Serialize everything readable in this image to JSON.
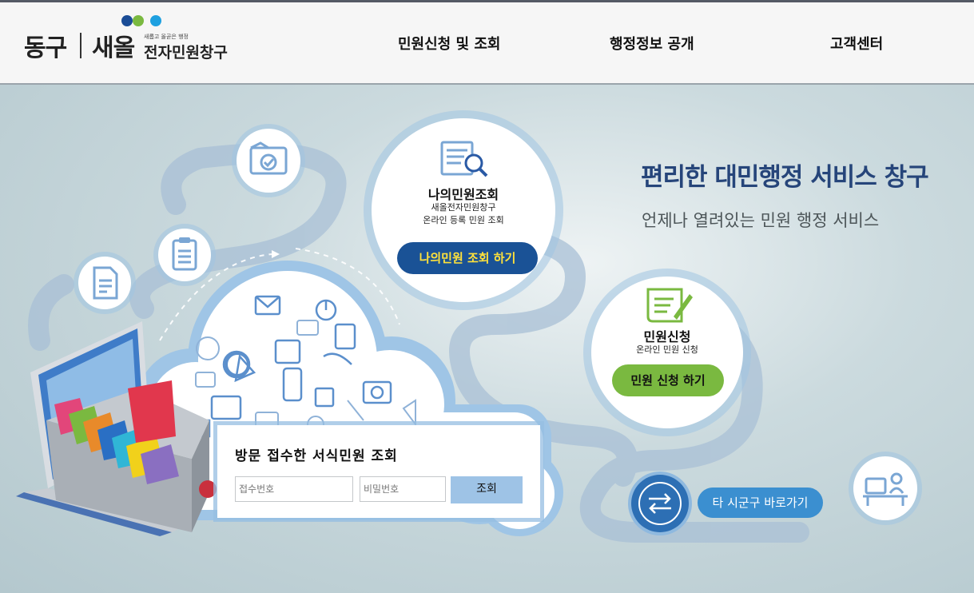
{
  "header": {
    "logo": {
      "district": "동구",
      "brand": "새올",
      "slogan": "새롭고 올곧은 행정",
      "service": "전자민원창구"
    },
    "nav": [
      {
        "label": "민원신청 및 조회"
      },
      {
        "label": "행정정보 공개"
      },
      {
        "label": "고객센터"
      }
    ]
  },
  "hero": {
    "title": "편리한 대민행정 서비스 창구",
    "subtitle": "언제나 열려있는 민원 행정 서비스"
  },
  "my_petition": {
    "title": "나의민원조회",
    "desc_line1": "새올전자민원창구",
    "desc_line2": "온라인 등록 민원 조회",
    "button_label": "나의민원 조회 하기",
    "icon": "document-search-icon"
  },
  "petition_apply": {
    "title": "민원신청",
    "desc": "온라인 민원 신청",
    "button_label": "민원 신청 하기",
    "icon": "scroll-pen-icon"
  },
  "lookup": {
    "title": "방문 접수한 서식민원 조회",
    "receipt_placeholder": "접수번호",
    "password_placeholder": "비밀번호",
    "button_label": "조회"
  },
  "other_region": {
    "button_label": "타 시군구 바로가기",
    "icon": "arrows-exchange-icon"
  },
  "colors": {
    "brand_navy": "#26457a",
    "blue_button": "#1a5296",
    "green_button": "#7ab940",
    "lookup_button": "#9ec3e6",
    "other_button": "#3b8fd0"
  }
}
